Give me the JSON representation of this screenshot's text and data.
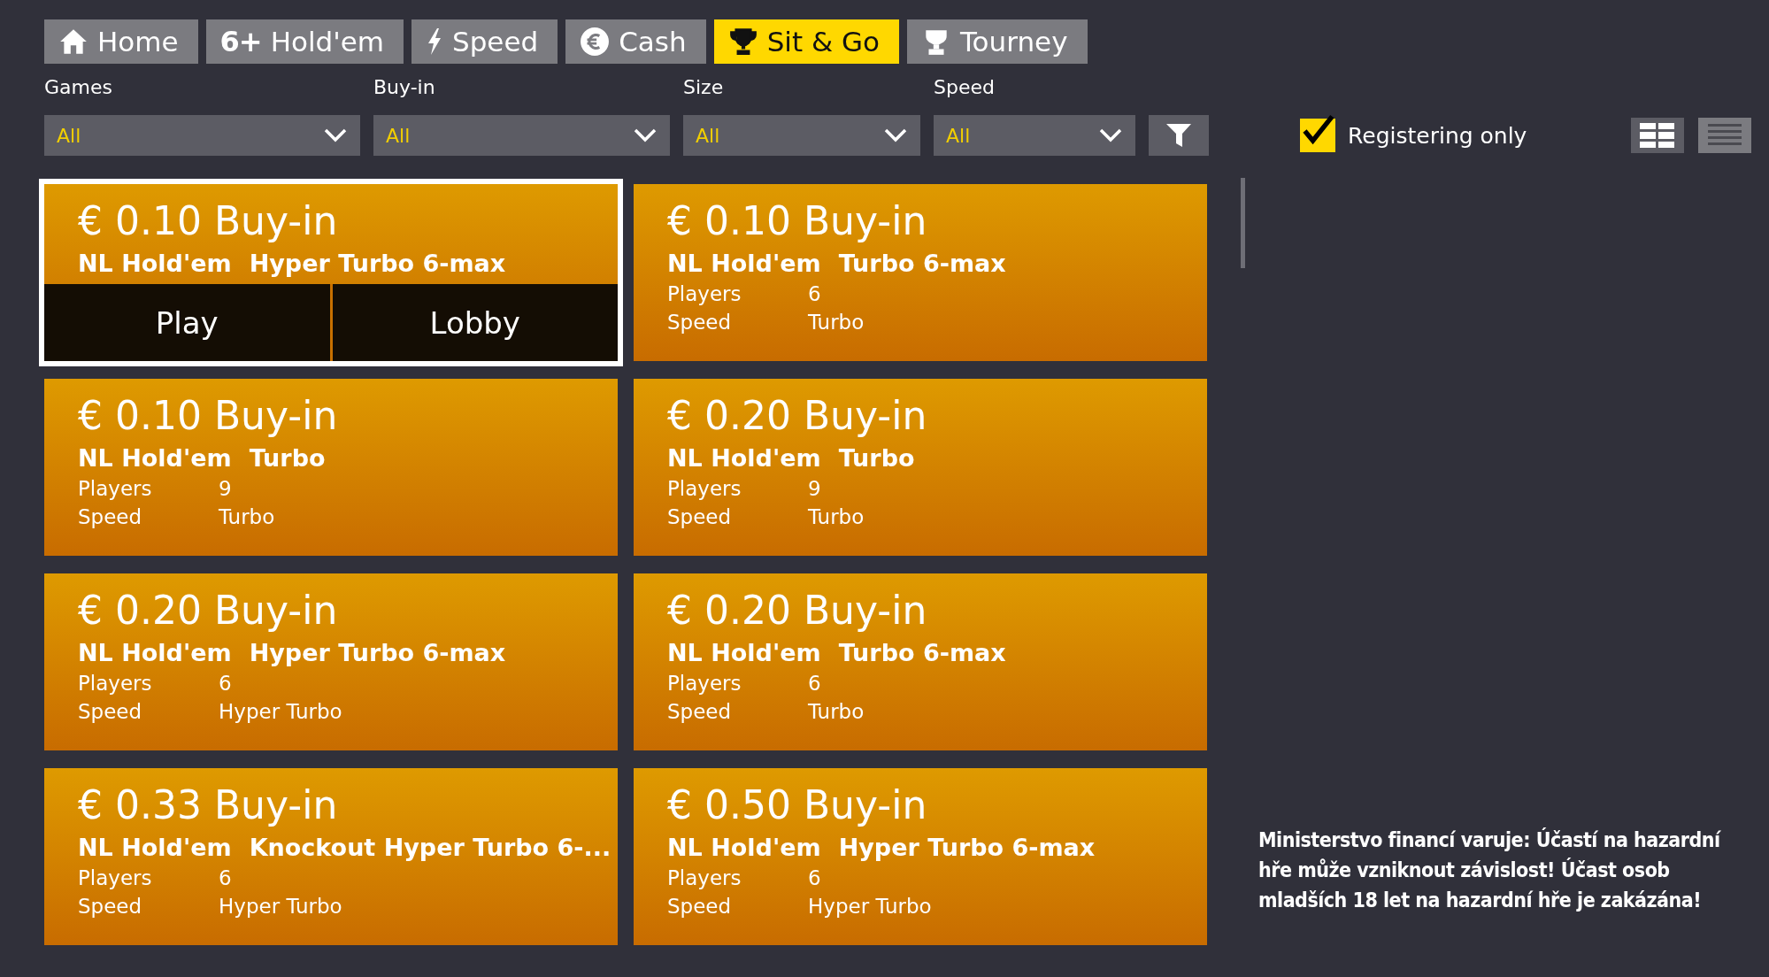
{
  "tabs": [
    {
      "label": "Home",
      "selected": false
    },
    {
      "label": "Hold'em",
      "badge": "6+",
      "selected": false
    },
    {
      "label": "Speed",
      "selected": false
    },
    {
      "label": "Cash",
      "selected": false
    },
    {
      "label": "Sit & Go",
      "selected": true
    },
    {
      "label": "Tourney",
      "selected": false
    }
  ],
  "filters": [
    {
      "label": "Games",
      "value": "All"
    },
    {
      "label": "Buy-in",
      "value": "All"
    },
    {
      "label": "Size",
      "value": "All"
    },
    {
      "label": "Speed",
      "value": "All"
    }
  ],
  "registering_only": {
    "label": "Registering only",
    "checked": true
  },
  "views": [
    {
      "selected": true
    },
    {
      "selected": false
    }
  ],
  "cards": [
    {
      "buyin": "€ 0.10 Buy-in",
      "game": "NL Hold'em",
      "type": "Hyper Turbo 6-max",
      "selected": true,
      "actions": [
        "Play",
        "Lobby"
      ]
    },
    {
      "buyin": "€ 0.10 Buy-in",
      "game": "NL Hold'em",
      "type": "Turbo 6-max",
      "players_label": "Players",
      "players": "6",
      "speed_label": "Speed",
      "speed": "Turbo",
      "selected": false
    },
    {
      "buyin": "€ 0.10 Buy-in",
      "game": "NL Hold'em",
      "type": "Turbo",
      "players_label": "Players",
      "players": "9",
      "speed_label": "Speed",
      "speed": "Turbo",
      "selected": false
    },
    {
      "buyin": "€ 0.20 Buy-in",
      "game": "NL Hold'em",
      "type": "Turbo",
      "players_label": "Players",
      "players": "9",
      "speed_label": "Speed",
      "speed": "Turbo",
      "selected": false
    },
    {
      "buyin": "€ 0.20 Buy-in",
      "game": "NL Hold'em",
      "type": "Hyper Turbo 6-max",
      "players_label": "Players",
      "players": "6",
      "speed_label": "Speed",
      "speed": "Hyper Turbo",
      "selected": false
    },
    {
      "buyin": "€ 0.20 Buy-in",
      "game": "NL Hold'em",
      "type": "Turbo 6-max",
      "players_label": "Players",
      "players": "6",
      "speed_label": "Speed",
      "speed": "Turbo",
      "selected": false
    },
    {
      "buyin": "€ 0.33 Buy-in",
      "game": "NL Hold'em",
      "type": "Knockout Hyper Turbo 6-...",
      "players_label": "Players",
      "players": "6",
      "speed_label": "Speed",
      "speed": "Hyper Turbo",
      "selected": false
    },
    {
      "buyin": "€ 0.50 Buy-in",
      "game": "NL Hold'em",
      "type": "Hyper Turbo 6-max",
      "players_label": "Players",
      "players": "6",
      "speed_label": "Speed",
      "speed": "Hyper Turbo",
      "selected": false
    }
  ],
  "warning": "Ministerstvo financí varuje: Účastí na hazardní hře může vzniknout závislost! Účast osob mladších 18 let na hazardní hře je zakázána!"
}
